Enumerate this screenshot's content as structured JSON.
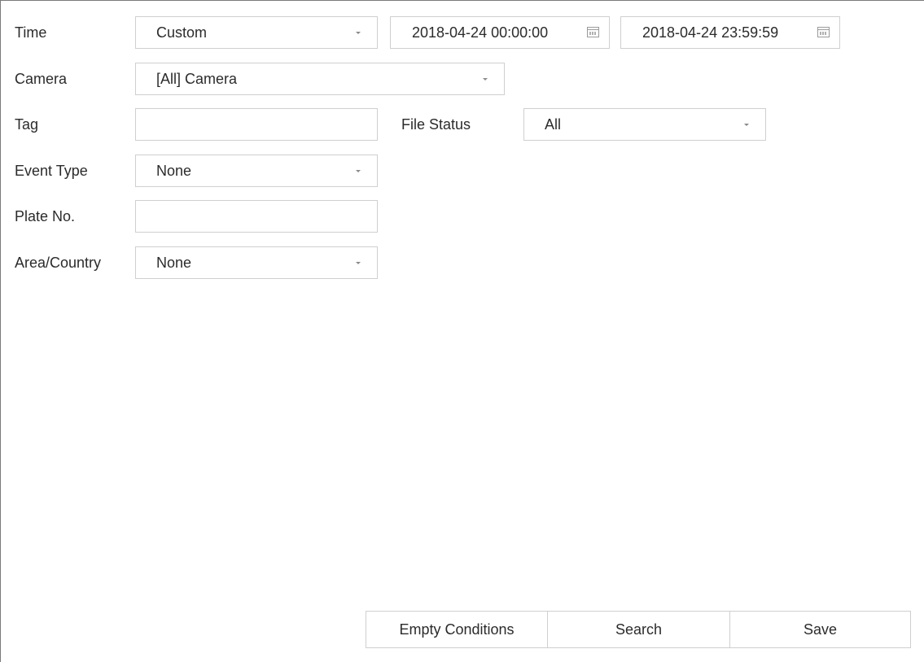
{
  "time": {
    "label": "Time",
    "mode": "Custom",
    "start": "2018-04-24 00:00:00",
    "end": "2018-04-24 23:59:59"
  },
  "camera": {
    "label": "Camera",
    "value": "[All] Camera"
  },
  "tag": {
    "label": "Tag",
    "value": ""
  },
  "file_status": {
    "label": "File Status",
    "value": "All"
  },
  "event_type": {
    "label": "Event Type",
    "value": "None"
  },
  "plate_no": {
    "label": "Plate No.",
    "value": ""
  },
  "area_country": {
    "label": "Area/Country",
    "value": "None"
  },
  "buttons": {
    "empty_conditions": "Empty Conditions",
    "search": "Search",
    "save": "Save"
  },
  "icons": {
    "dropdown": "chevron-down-icon",
    "calendar": "calendar-icon"
  }
}
